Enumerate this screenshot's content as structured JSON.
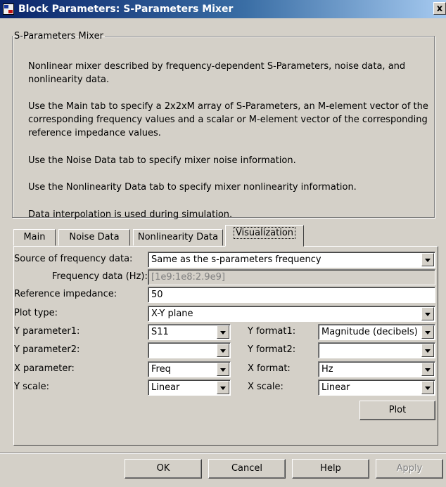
{
  "window": {
    "title": "Block Parameters: S-Parameters Mixer",
    "close_label": "x"
  },
  "description": {
    "group_title": "S-Parameters Mixer",
    "paragraphs": [
      "Nonlinear mixer described by frequency-dependent S-Parameters, noise data, and nonlinearity data.",
      "Use the Main tab to specify a 2x2xM array of S-Parameters, an M-element vector of the corresponding frequency values and a scalar or M-element vector of the corresponding reference impedance values.",
      "Use the Noise Data tab to specify mixer noise information.",
      "Use the Nonlinearity Data tab to specify mixer nonlinearity information.",
      "Data interpolation is used during simulation."
    ]
  },
  "tabs": [
    {
      "label": "Main"
    },
    {
      "label": "Noise Data"
    },
    {
      "label": "Nonlinearity Data"
    },
    {
      "label": "Visualization"
    }
  ],
  "visualization": {
    "source_label": "Source of frequency data:",
    "source_value": "Same as the s-parameters frequency",
    "freq_label": "Frequency data (Hz):",
    "freq_value": "[1e9:1e8:2.9e9]",
    "ref_label": "Reference impedance:",
    "ref_value": "50",
    "plot_type_label": "Plot type:",
    "plot_type_value": "X-Y plane",
    "y_param1_label": "Y parameter1:",
    "y_param1_value": "S11",
    "y_format1_label": "Y format1:",
    "y_format1_value": "Magnitude (decibels)",
    "y_param2_label": "Y parameter2:",
    "y_param2_value": "",
    "y_format2_label": "Y format2:",
    "y_format2_value": "",
    "x_param_label": "X parameter:",
    "x_param_value": "Freq",
    "x_format_label": "X format:",
    "x_format_value": "Hz",
    "y_scale_label": "Y scale:",
    "y_scale_value": "Linear",
    "x_scale_label": "X scale:",
    "x_scale_value": "Linear",
    "plot_button": "Plot"
  },
  "footer": {
    "ok": "OK",
    "cancel": "Cancel",
    "help": "Help",
    "apply": "Apply"
  }
}
